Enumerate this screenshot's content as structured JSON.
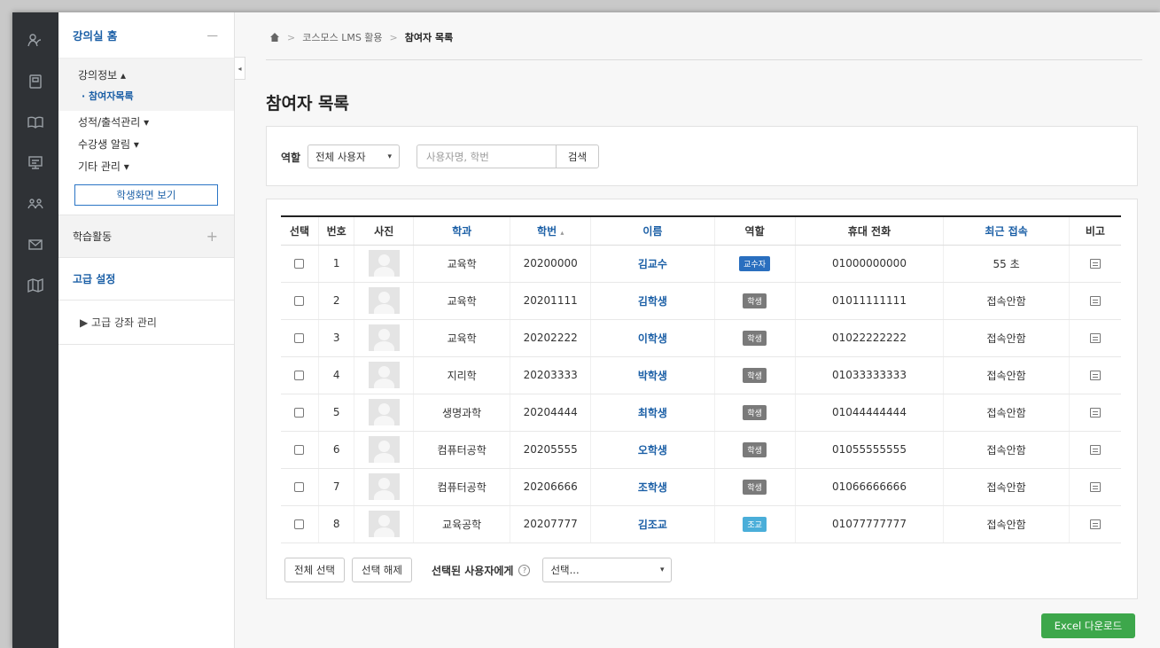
{
  "rail_icons": [
    "users-icon",
    "tablet-icon",
    "book-open-icon",
    "presentation-icon",
    "group-icon",
    "mail-icon",
    "map-icon"
  ],
  "sidebar": {
    "home_label": "강의실 홈",
    "home_toggle": "—",
    "course_info": "강의정보 ▴",
    "participants": "· 참여자목록",
    "grades": "성적/출석관리 ▾",
    "notify": "수강생 알림 ▾",
    "misc": "기타 관리 ▾",
    "student_view_button": "학생화면 보기",
    "learning_activity": "학습활동",
    "learning_plus": "+",
    "advanced_settings": "고급 설정",
    "advanced_course": "▶  고급 강좌 관리"
  },
  "breadcrumb": {
    "item1": "코스모스 LMS 활용",
    "sep": ">",
    "current": "참여자 목록"
  },
  "page_title": "참여자 목록",
  "filter": {
    "role_label": "역할",
    "role_value": "전체 사용자",
    "search_placeholder": "사용자명, 학번",
    "search_button": "검색"
  },
  "table": {
    "headers": {
      "select": "선택",
      "number": "번호",
      "photo": "사진",
      "dept": "학과",
      "student_id": "학번",
      "sort_icon": "▴",
      "name": "이름",
      "role": "역할",
      "phone": "휴대 전화",
      "last_access": "최근 접속",
      "note": "비고"
    },
    "rows": [
      {
        "no": "1",
        "dept": "교육학",
        "sid": "20200000",
        "name": "김교수",
        "role": "교수자",
        "role_color": "#2a6fbf",
        "phone": "01000000000",
        "access": "55 초"
      },
      {
        "no": "2",
        "dept": "교육학",
        "sid": "20201111",
        "name": "김학생",
        "role": "학생",
        "role_color": "#7a7a7a",
        "phone": "01011111111",
        "access": "접속안함"
      },
      {
        "no": "3",
        "dept": "교육학",
        "sid": "20202222",
        "name": "이학생",
        "role": "학생",
        "role_color": "#7a7a7a",
        "phone": "01022222222",
        "access": "접속안함"
      },
      {
        "no": "4",
        "dept": "지리학",
        "sid": "20203333",
        "name": "박학생",
        "role": "학생",
        "role_color": "#7a7a7a",
        "phone": "01033333333",
        "access": "접속안함"
      },
      {
        "no": "5",
        "dept": "생명과학",
        "sid": "20204444",
        "name": "최학생",
        "role": "학생",
        "role_color": "#7a7a7a",
        "phone": "01044444444",
        "access": "접속안함"
      },
      {
        "no": "6",
        "dept": "컴퓨터공학",
        "sid": "20205555",
        "name": "오학생",
        "role": "학생",
        "role_color": "#7a7a7a",
        "phone": "01055555555",
        "access": "접속안함"
      },
      {
        "no": "7",
        "dept": "컴퓨터공학",
        "sid": "20206666",
        "name": "조학생",
        "role": "학생",
        "role_color": "#7a7a7a",
        "phone": "01066666666",
        "access": "접속안함"
      },
      {
        "no": "8",
        "dept": "교육공학",
        "sid": "20207777",
        "name": "김조교",
        "role": "조교",
        "role_color": "#4aaed9",
        "phone": "01077777777",
        "access": "접속안함"
      }
    ]
  },
  "actions": {
    "select_all": "전체 선택",
    "deselect": "선택 해제",
    "to_selected": "선택된 사용자에게",
    "help": "?",
    "action_select": "선택..."
  },
  "excel_button": "Excel 다운로드"
}
